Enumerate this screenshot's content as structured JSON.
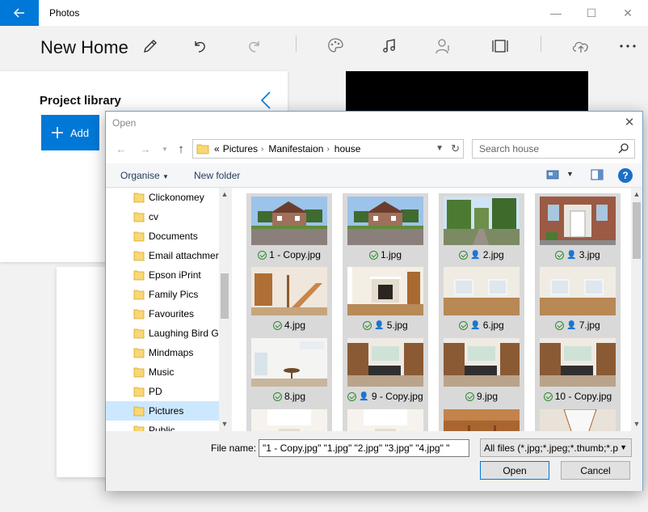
{
  "app": {
    "title": "Photos",
    "project_title": "New Home"
  },
  "library": {
    "title": "Project library",
    "add_label": "Add"
  },
  "dialog": {
    "title": "Open",
    "breadcrumb_prefix": "«",
    "breadcrumbs": [
      "Pictures",
      "Manifestaion",
      "house"
    ],
    "search_placeholder": "Search house",
    "organise_label": "Organise",
    "new_folder_label": "New folder",
    "nav_items": [
      {
        "label": "Clickonomey"
      },
      {
        "label": "cv"
      },
      {
        "label": "Documents"
      },
      {
        "label": "Email attachmer"
      },
      {
        "label": "Epson iPrint"
      },
      {
        "label": "Family Pics"
      },
      {
        "label": "Favourites"
      },
      {
        "label": "Laughing Bird G"
      },
      {
        "label": "Mindmaps"
      },
      {
        "label": "Music"
      },
      {
        "label": "PD"
      },
      {
        "label": "Pictures",
        "selected": true
      },
      {
        "label": "Public"
      }
    ],
    "files": [
      {
        "name": "1 - Copy.jpg",
        "shared": false,
        "scene": "house"
      },
      {
        "name": "1.jpg",
        "shared": false,
        "scene": "house"
      },
      {
        "name": "2.jpg",
        "shared": true,
        "scene": "garden"
      },
      {
        "name": "3.jpg",
        "shared": true,
        "scene": "door"
      },
      {
        "name": "4.jpg",
        "shared": false,
        "scene": "stairs"
      },
      {
        "name": "5.jpg",
        "shared": true,
        "scene": "fireplace"
      },
      {
        "name": "6.jpg",
        "shared": true,
        "scene": "room"
      },
      {
        "name": "7.jpg",
        "shared": true,
        "scene": "room"
      },
      {
        "name": "8.jpg",
        "shared": false,
        "scene": "dining"
      },
      {
        "name": "9 - Copy.jpg",
        "shared": true,
        "scene": "kitchen"
      },
      {
        "name": "9.jpg",
        "shared": false,
        "scene": "kitchen"
      },
      {
        "name": "10 - Copy.jpg",
        "shared": false,
        "scene": "kitchen"
      },
      {
        "name": "",
        "shared": false,
        "scene": "ceiling"
      },
      {
        "name": "",
        "shared": false,
        "scene": "ceiling"
      },
      {
        "name": "",
        "shared": false,
        "scene": "wood"
      },
      {
        "name": "",
        "shared": false,
        "scene": "skylight"
      }
    ],
    "filename_label": "File name:",
    "filename_value": "\"1 - Copy.jpg\" \"1.jpg\" \"2.jpg\" \"3.jpg\" \"4.jpg\" \"",
    "filetype_value": "All files (*.jpg;*.jpeg;*.thumb;*.p",
    "open_label": "Open",
    "cancel_label": "Cancel"
  },
  "colors": {
    "accent": "#0078d7",
    "tile_bg": "#d9d9d9",
    "selected_nav": "#cce8ff"
  }
}
